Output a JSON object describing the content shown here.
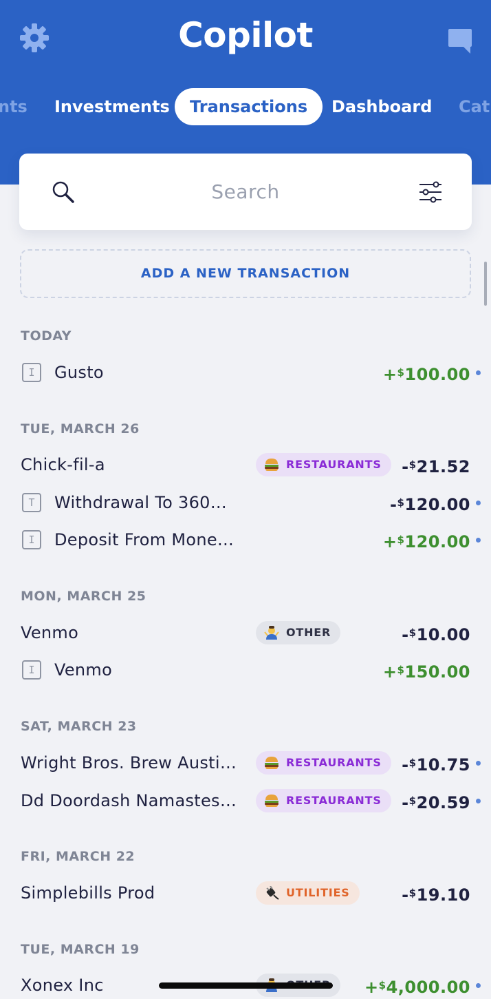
{
  "app": {
    "title": "Copilot"
  },
  "tabs": [
    "nts",
    "Investments",
    "Transactions",
    "Dashboard",
    "Cat"
  ],
  "search": {
    "placeholder": "Search"
  },
  "add_transaction": "ADD A NEW TRANSACTION",
  "groups": [
    {
      "date": "TODAY",
      "items": [
        {
          "icon": "I",
          "merchant": "Gusto",
          "amount_sign": "+",
          "amount": "100.00",
          "pending": true,
          "positive": true
        }
      ]
    },
    {
      "date": "TUE, MARCH 26",
      "items": [
        {
          "merchant": "Chick-fil-a",
          "category": "RESTAURANTS",
          "category_icon": "burger-icon",
          "amount_sign": "-",
          "amount": "21.52",
          "pending": false,
          "positive": false
        },
        {
          "icon": "T",
          "merchant": "Withdrawal To 360…",
          "amount_sign": "-",
          "amount": "120.00",
          "pending": true,
          "positive": false
        },
        {
          "icon": "I",
          "merchant": "Deposit From Mone…",
          "amount_sign": "+",
          "amount": "120.00",
          "pending": true,
          "positive": true
        }
      ]
    },
    {
      "date": "MON, MARCH 25",
      "items": [
        {
          "merchant": "Venmo",
          "category": "OTHER",
          "category_icon": "shrug-icon",
          "amount_sign": "-",
          "amount": "10.00",
          "pending": false,
          "positive": false
        },
        {
          "icon": "I",
          "merchant": "Venmo",
          "amount_sign": "+",
          "amount": "150.00",
          "pending": false,
          "positive": true
        }
      ]
    },
    {
      "date": "SAT, MARCH 23",
      "items": [
        {
          "merchant": "Wright Bros. Brew Austi…",
          "category": "RESTAURANTS",
          "category_icon": "burger-icon",
          "amount_sign": "-",
          "amount": "10.75",
          "pending": true,
          "positive": false
        },
        {
          "merchant": "Dd Doordash Namastes…",
          "category": "RESTAURANTS",
          "category_icon": "burger-icon",
          "amount_sign": "-",
          "amount": "20.59",
          "pending": true,
          "positive": false
        }
      ]
    },
    {
      "date": "FRI, MARCH 22",
      "items": [
        {
          "merchant": "Simplebills Prod",
          "category": "UTILITIES",
          "category_icon": "plug-icon",
          "amount_sign": "-",
          "amount": "19.10",
          "pending": false,
          "positive": false
        }
      ]
    },
    {
      "date": "TUE, MARCH 19",
      "items": [
        {
          "merchant": "Xonex Inc",
          "category": "OTHER",
          "category_icon": "shrug-icon",
          "amount_sign": "+",
          "amount": "4,000.00",
          "pending": true,
          "positive": true
        }
      ]
    }
  ],
  "currency_symbol": "$",
  "colors": {
    "header": "#2b62c5",
    "positive": "#3d8f2f",
    "restaurants": "#8a2bd6",
    "utilities": "#e0642a",
    "pending_dot": "#5b86d8"
  }
}
